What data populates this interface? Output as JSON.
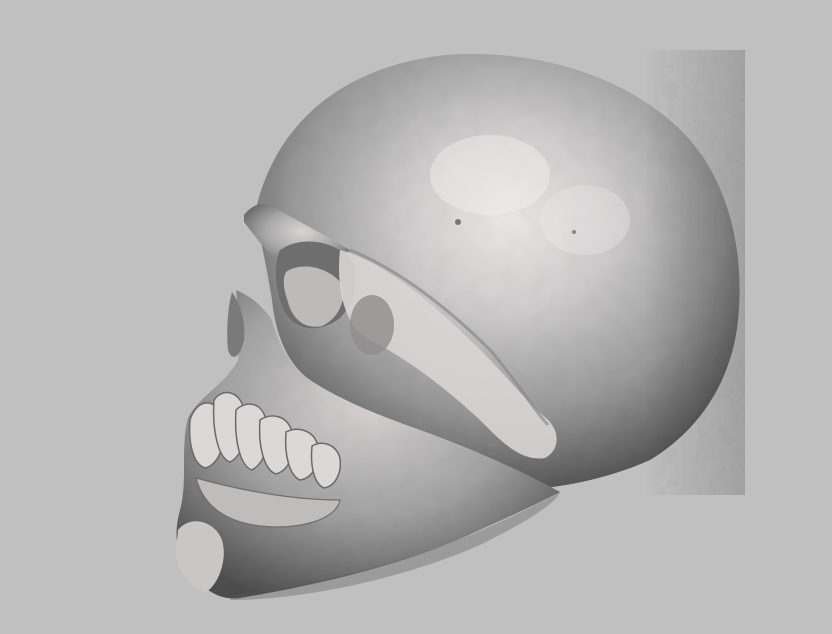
{
  "scene": {
    "subject": "skull",
    "view": "left-side-three-quarter",
    "background_color": "#c0c0c0",
    "mesh_color": "#a6a6a6",
    "highlight_color": "#eeeaea",
    "shadow_color": "#4a4a4a"
  }
}
